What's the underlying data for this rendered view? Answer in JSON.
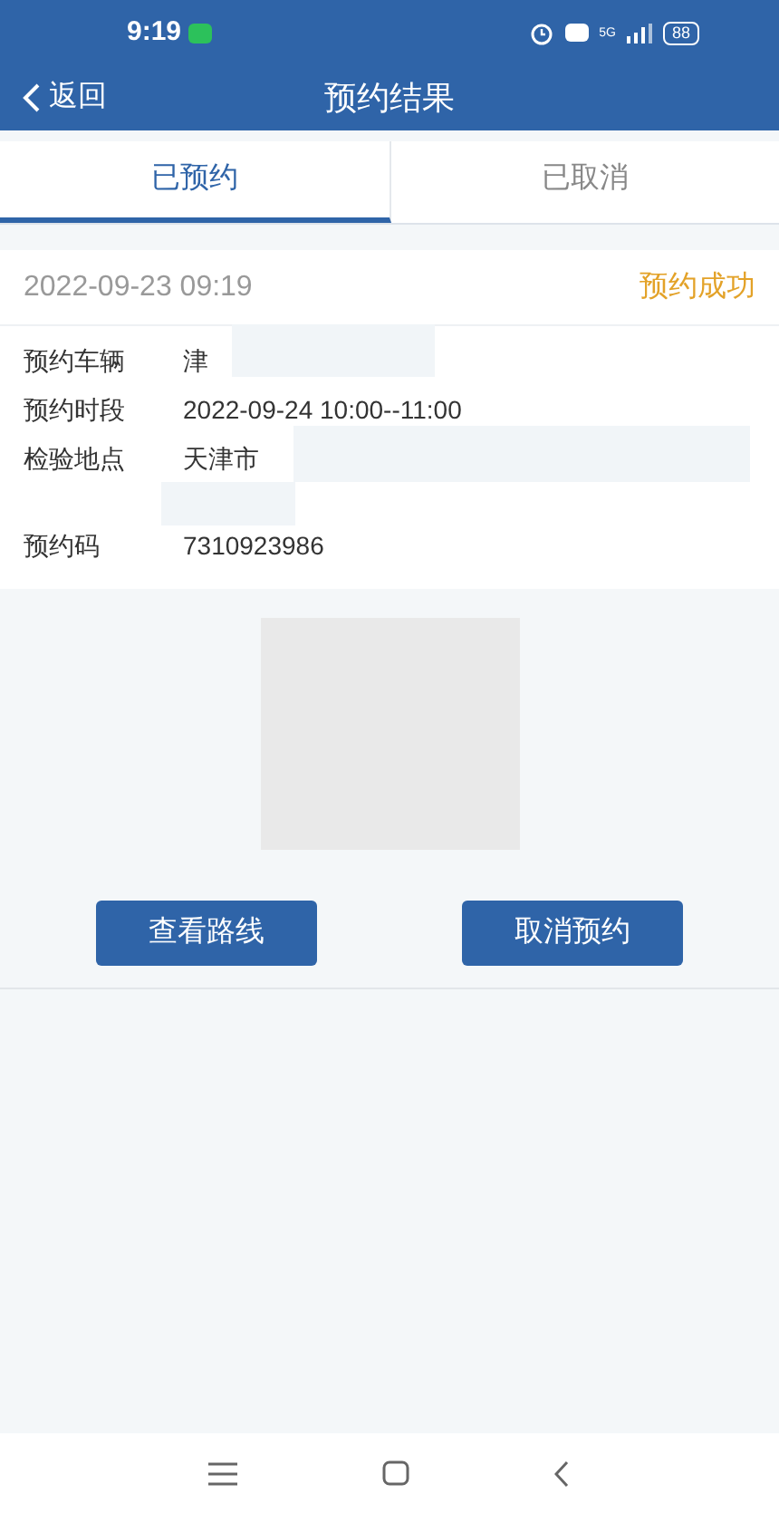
{
  "status_bar": {
    "time": "9:19",
    "battery": "88",
    "network": "5G"
  },
  "header": {
    "back_label": "返回",
    "title": "预约结果"
  },
  "tabs": [
    {
      "label": "已预约",
      "selected": true
    },
    {
      "label": "已取消",
      "selected": false
    }
  ],
  "record": {
    "created": "2022-09-23 09:19",
    "status": "预约成功",
    "fields": [
      {
        "label": "预约车辆",
        "value": "津"
      },
      {
        "label": "预约时段",
        "value": "2022-09-24 10:00--11:00"
      },
      {
        "label": "检验地点",
        "value": "天津市"
      },
      {
        "label": "预约码",
        "value": "7310923986"
      }
    ]
  },
  "buttons": [
    "查看路线",
    "取消预约"
  ]
}
